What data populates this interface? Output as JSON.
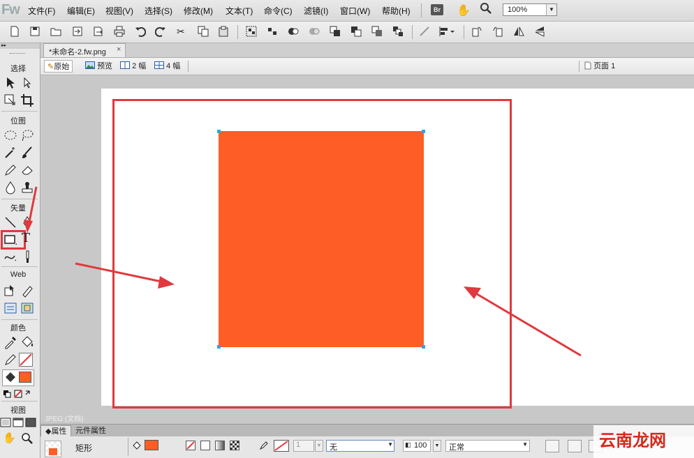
{
  "app": {
    "logo": "Fw"
  },
  "menu": [
    {
      "label": "文件(F)"
    },
    {
      "label": "编辑(E)"
    },
    {
      "label": "视图(V)"
    },
    {
      "label": "选择(S)"
    },
    {
      "label": "修改(M)"
    },
    {
      "label": "文本(T)"
    },
    {
      "label": "命令(C)"
    },
    {
      "label": "滤镜(I)"
    },
    {
      "label": "窗口(W)"
    },
    {
      "label": "帮助(H)"
    }
  ],
  "menu_right": {
    "bridge_label": "Br",
    "zoom_value": "100%"
  },
  "tools": {
    "sections": {
      "select": "选择",
      "bitmap": "位图",
      "vector": "矢量",
      "web": "Web",
      "colors": "颜色",
      "view": "视图"
    },
    "text_tool_glyph": "T",
    "fill_color": "#fe5d26"
  },
  "document": {
    "tab_title": "*未命名-2.fw.png",
    "tab_close": "×",
    "views": {
      "original": "原始",
      "preview": "预览",
      "two_up": "2 幅",
      "four_up": "4 幅"
    },
    "page_label": "页面 1",
    "status_text": "JPEG (文档)"
  },
  "canvas": {
    "shape_color": "#fe5d26",
    "frame_color": "#e0393e",
    "arrow_color": "#e0393e"
  },
  "properties": {
    "tab_properties": "属性",
    "tab_symbol": "元件属性",
    "object_type": "矩形",
    "fill_color": "#fe5d26",
    "stroke_width": "1",
    "texture": "无",
    "opacity": "100",
    "blend_mode": "正常"
  },
  "watermark": "云南龙网"
}
